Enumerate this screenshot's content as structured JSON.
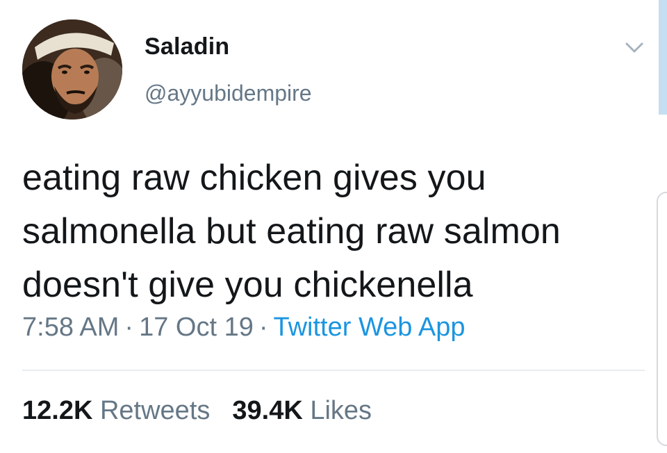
{
  "tweet": {
    "author": {
      "display_name": "Saladin",
      "handle": "@ayyubidempire",
      "avatar": "profile-photo"
    },
    "text": "eating raw chicken gives you salmonella but eating raw salmon doesn't give you chickenella",
    "time": "7:58 AM",
    "date": "17 Oct 19",
    "separator": "·",
    "source": "Twitter Web App",
    "stats": {
      "retweets_count": "12.2K",
      "retweets_label": "Retweets",
      "likes_count": "39.4K",
      "likes_label": "Likes"
    }
  },
  "icons": {
    "menu": "chevron-down-icon"
  },
  "colors": {
    "text": "#14171a",
    "secondary": "#657786",
    "link": "#1b95e0",
    "divider": "#e6ecf0"
  }
}
